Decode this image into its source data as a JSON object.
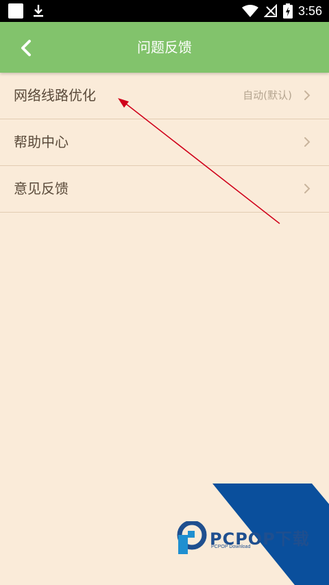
{
  "status_bar": {
    "time": "3:56"
  },
  "header": {
    "title": "问题反馈"
  },
  "list": {
    "items": [
      {
        "label": "网络线路优化",
        "value": "自动(默认)"
      },
      {
        "label": "帮助中心",
        "value": ""
      },
      {
        "label": "意见反馈",
        "value": ""
      }
    ]
  },
  "watermark": {
    "brand": "PCPOP下载",
    "subtitle": "PCPOP Download"
  },
  "colors": {
    "header_bg": "#82c36c",
    "page_bg": "#faebd9",
    "annotation_arrow": "#d0021b",
    "watermark_blue": "#1f4f8f"
  }
}
